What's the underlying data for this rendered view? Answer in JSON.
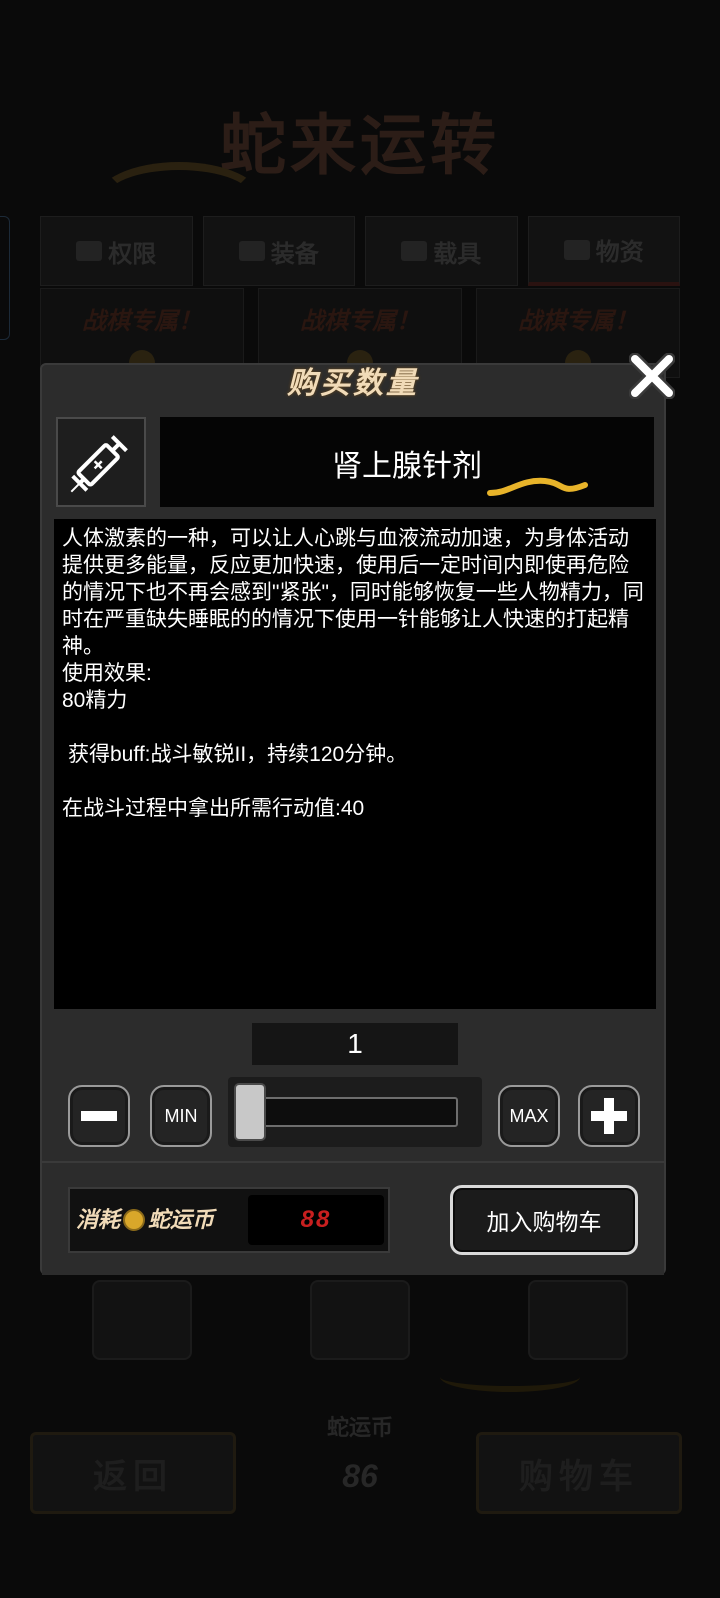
{
  "background": {
    "title": "蛇来运转",
    "tabs": [
      {
        "label": "权限",
        "icon": "box-icon"
      },
      {
        "label": "装备",
        "icon": "shield-icon"
      },
      {
        "label": "载具",
        "icon": "car-icon"
      },
      {
        "label": "物资",
        "icon": "crate-icon"
      }
    ],
    "card_badge": "战棋专属！",
    "back_label": "返回",
    "cart_label": "购物车",
    "currency_label": "蛇运币",
    "currency_amount": "86"
  },
  "dialog": {
    "title": "购买数量",
    "close_icon": "close-icon",
    "item_icon": "syringe-icon",
    "item_name": "肾上腺针剂",
    "description": {
      "paragraph": "人体激素的一种，可以让人心跳与血液流动加速，为身体活动提供更多能量，反应更加快速，使用后一定时间内即使再危险的情况下也不再会感到\"紧张\"，同时能够恢复一些人物精力，同时在严重缺失睡眠的的情况下使用一针能够让人快速的打起精神。",
      "effect_header": "使用效果:",
      "effect_value": "80精力",
      "buff": "获得buff:战斗敏锐II，持续120分钟。",
      "action_cost": "在战斗过程中拿出所需行动值:40"
    },
    "quantity": "1",
    "min_label": "MIN",
    "max_label": "MAX",
    "slider_level": 0.0,
    "cost_label": "消耗",
    "cost_currency": "蛇运币",
    "cost_value": "88",
    "add_to_cart_label": "加入购物车"
  }
}
